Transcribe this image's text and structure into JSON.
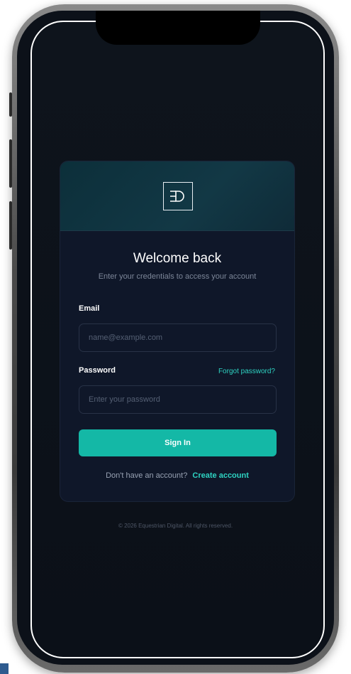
{
  "brand": {
    "logo_icon": "ed-monogram-icon",
    "accent_color": "#14b8a6",
    "link_color": "#2ed3c2"
  },
  "login": {
    "title": "Welcome back",
    "subtitle": "Enter your credentials to access your account",
    "email_label": "Email",
    "email_placeholder": "name@example.com",
    "email_value": "",
    "password_label": "Password",
    "forgot_password": "Forgot password?",
    "password_placeholder": "Enter your password",
    "password_value": "",
    "signin_label": "Sign In",
    "signup_prompt": "Don't have an account?",
    "signup_link": "Create account"
  },
  "footer": {
    "copyright": "© 2026 Equestrian Digital. All rights reserved."
  }
}
